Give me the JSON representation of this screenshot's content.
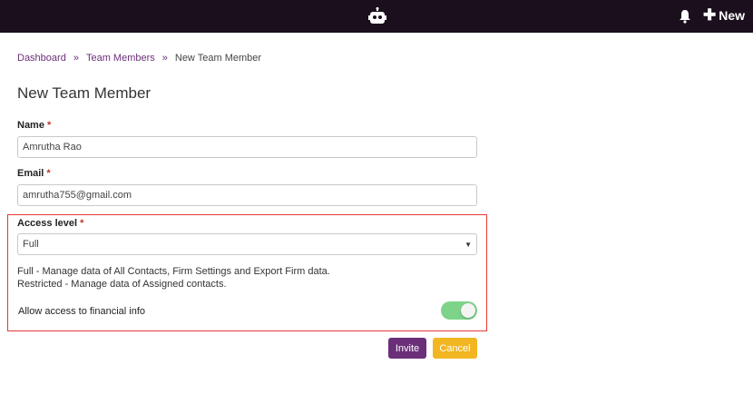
{
  "header": {
    "new_label": "New",
    "logo_icon": "robot-logo-icon",
    "notification_icon": "bell-icon",
    "background": "#1b0f1d"
  },
  "breadcrumb": {
    "items": [
      "Dashboard",
      "Team Members"
    ],
    "separator": "»",
    "current": "New Team Member"
  },
  "page": {
    "title": "New Team Member"
  },
  "form": {
    "name": {
      "label": "Name",
      "required_mark": "*",
      "value": "Amrutha Rao"
    },
    "email": {
      "label": "Email",
      "required_mark": "*",
      "value": "amrutha755@gmail.com"
    },
    "access_level": {
      "label": "Access level",
      "required_mark": "*",
      "selected": "Full",
      "help_full": "Full - Manage data of All Contacts, Firm Settings and Export Firm data.",
      "help_restricted": "Restricted - Manage data of Assigned contacts."
    },
    "financial_toggle": {
      "label": "Allow access to financial info",
      "on": true
    }
  },
  "actions": {
    "invite_label": "Invite",
    "cancel_label": "Cancel"
  },
  "colors": {
    "accent": "#6b2f7a",
    "cancel": "#f2b622",
    "toggle_on": "#7dd388",
    "highlight_border": "#e53935"
  }
}
